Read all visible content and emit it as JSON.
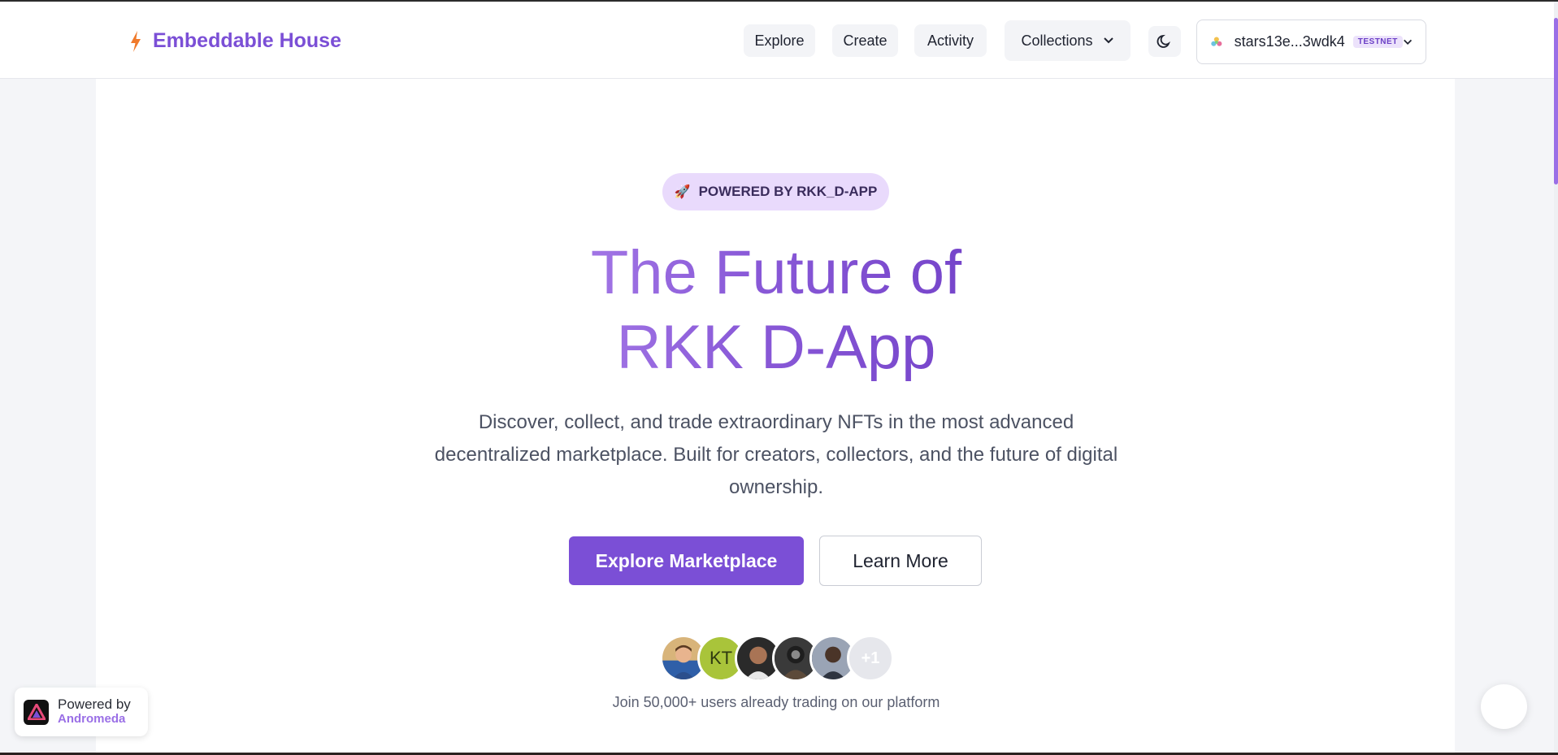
{
  "header": {
    "brand_name": "Embeddable House",
    "nav": {
      "explore": "Explore",
      "create": "Create",
      "activity": "Activity",
      "collections": "Collections"
    },
    "wallet": {
      "address": "stars13e...3wdk4",
      "network_badge": "TESTNET"
    }
  },
  "hero": {
    "badge_icon": "🚀",
    "badge_text": "POWERED BY RKK_D-APP",
    "title_line1": "The Future of",
    "title_line2": "RKK D-App",
    "subtitle": "Discover, collect, and trade extraordinary NFTs in the most advanced decentralized marketplace. Built for creators, collectors, and the future of digital ownership.",
    "primary_button": "Explore Marketplace",
    "secondary_button": "Learn More"
  },
  "community": {
    "avatar_initials": "KT",
    "more_count": "+1",
    "join_text": "Join 50,000+ users already trading on our platform"
  },
  "footer_widget": {
    "powered_by": "Powered by",
    "name": "Andromeda"
  },
  "colors": {
    "brand_purple": "#7b4fd6",
    "bolt_orange": "#f07a2b",
    "badge_bg": "#e9dafc"
  },
  "icons": [
    "bolt-icon",
    "chevron-down-icon",
    "moon-icon",
    "wallet-logo-icon",
    "rocket-icon",
    "andromeda-logo-icon"
  ]
}
